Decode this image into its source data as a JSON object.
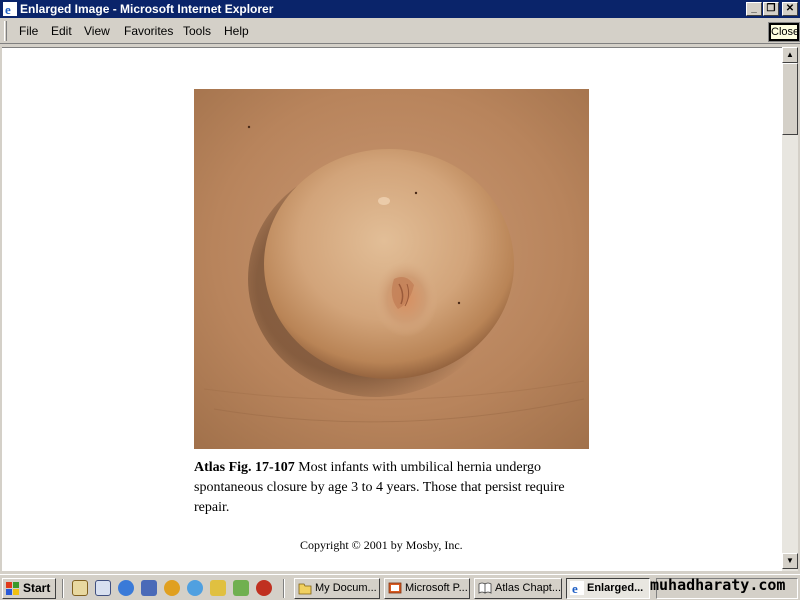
{
  "window": {
    "title": "Enlarged Image - Microsoft Internet Explorer",
    "minimize_glyph": "_",
    "restore_glyph": "❐",
    "close_glyph": "✕"
  },
  "menubar": {
    "items": [
      {
        "label": "File"
      },
      {
        "label": "Edit"
      },
      {
        "label": "View"
      },
      {
        "label": "Favorites"
      },
      {
        "label": "Tools"
      },
      {
        "label": "Help"
      }
    ]
  },
  "tooltip": {
    "text": "Close"
  },
  "content": {
    "caption_bold": "Atlas Fig. 17-107",
    "caption_text": " Most infants with umbilical hernia undergo spontaneous closure by age 3 to 4 years. Those that persist require repair.",
    "copyright": "Copyright © 2001 by Mosby, Inc."
  },
  "scrollbar": {
    "up_glyph": "▲",
    "down_glyph": "▼"
  },
  "taskbar": {
    "start_label": "Start",
    "tasks": [
      {
        "label": "My Docum..."
      },
      {
        "label": "Microsoft P..."
      },
      {
        "label": "Atlas Chapt..."
      },
      {
        "label": "Enlarged..."
      }
    ],
    "watermark": "muhadharaty.com"
  },
  "colors": {
    "titlebar": "#0a246a",
    "chrome": "#d4d0c8",
    "skin": "#c08860"
  },
  "icons": [
    "ie-icon",
    "windows-logo-icon",
    "show-desktop-icon",
    "search-icon",
    "ie-quicklaunch-icon",
    "outlook-icon",
    "media-player-icon",
    "messenger-icon",
    "ruler-icon",
    "paint-icon",
    "folder-icon",
    "powerpoint-icon",
    "book-icon"
  ]
}
